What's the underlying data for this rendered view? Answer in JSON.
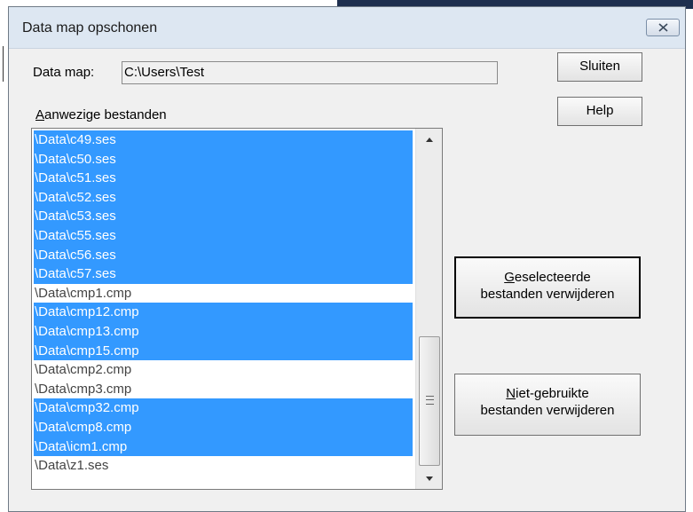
{
  "window": {
    "title": "Data map opschonen"
  },
  "data_map": {
    "label": "Data map:",
    "value": "C:\\Users\\Test"
  },
  "files": {
    "label_accel": "A",
    "label_rest": "anwezige bestanden",
    "items": [
      {
        "name": "\\Data\\c49.ses",
        "selected": true
      },
      {
        "name": "\\Data\\c50.ses",
        "selected": true
      },
      {
        "name": "\\Data\\c51.ses",
        "selected": true
      },
      {
        "name": "\\Data\\c52.ses",
        "selected": true
      },
      {
        "name": "\\Data\\c53.ses",
        "selected": true
      },
      {
        "name": "\\Data\\c55.ses",
        "selected": true
      },
      {
        "name": "\\Data\\c56.ses",
        "selected": true
      },
      {
        "name": "\\Data\\c57.ses",
        "selected": true
      },
      {
        "name": "\\Data\\cmp1.cmp",
        "selected": false
      },
      {
        "name": "\\Data\\cmp12.cmp",
        "selected": true
      },
      {
        "name": "\\Data\\cmp13.cmp",
        "selected": true
      },
      {
        "name": "\\Data\\cmp15.cmp",
        "selected": true
      },
      {
        "name": "\\Data\\cmp2.cmp",
        "selected": false
      },
      {
        "name": "\\Data\\cmp3.cmp",
        "selected": false
      },
      {
        "name": "\\Data\\cmp32.cmp",
        "selected": true
      },
      {
        "name": "\\Data\\cmp8.cmp",
        "selected": true
      },
      {
        "name": "\\Data\\icm1.cmp",
        "selected": true
      },
      {
        "name": "\\Data\\z1.ses",
        "selected": false
      }
    ]
  },
  "buttons": {
    "close": "Sluiten",
    "help": "Help",
    "delete_selected_accel": "G",
    "delete_selected_line1_rest": "eselecteerde",
    "delete_selected_line2": "bestanden verwijderen",
    "delete_unused_accel": "N",
    "delete_unused_line1_rest": "iet-gebruikte",
    "delete_unused_line2": "bestanden verwijderen"
  },
  "icons": {
    "close": "close-x-icon",
    "scroll_up": "scroll-up-arrow-icon",
    "scroll_down": "scroll-down-arrow-icon",
    "thumb_grip": "scroll-grip-icon"
  },
  "colors": {
    "selection": "#3399ff",
    "titlebar": "#dde7f2",
    "dialog_bg": "#f0f0f0"
  }
}
